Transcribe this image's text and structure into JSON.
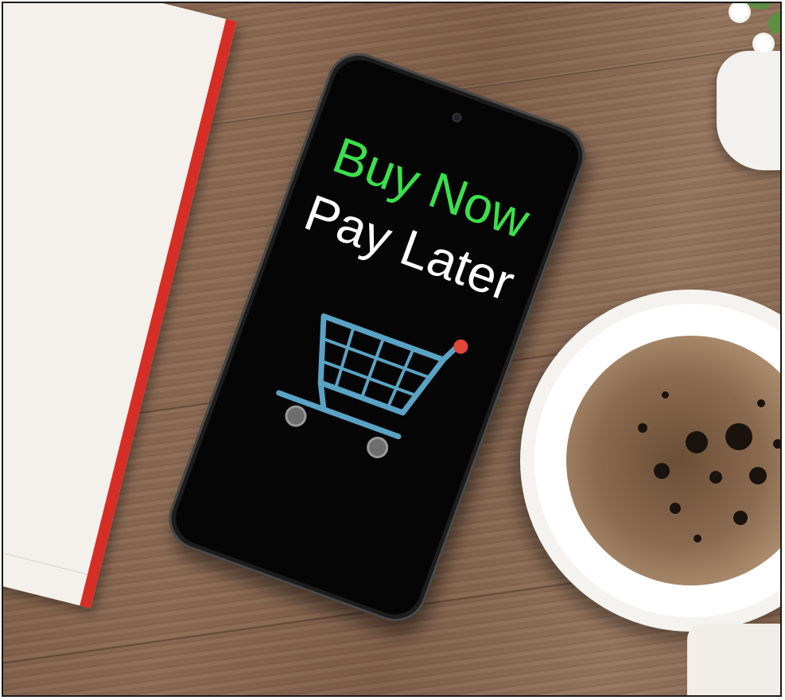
{
  "scene": {
    "phone_screen": {
      "headline_line1": "Buy Now",
      "headline_line2": "Pay Later",
      "cart_icon": "shopping-cart-icon"
    }
  },
  "colors": {
    "headline_green": "#3be04d",
    "headline_white": "#ffffff",
    "cart_blue": "#5aa3c4",
    "cart_handle_red": "#e2453c",
    "notebook_red": "#d62d25"
  }
}
